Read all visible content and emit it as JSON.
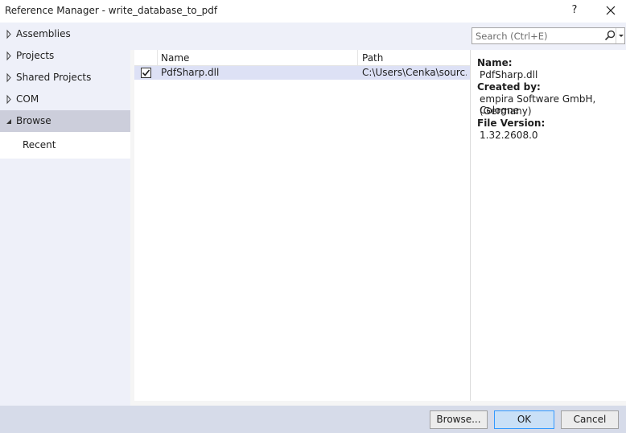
{
  "window": {
    "title": "Reference Manager - write_database_to_pdf",
    "help_label": "?"
  },
  "nav": {
    "items": [
      {
        "label": "Assemblies"
      },
      {
        "label": "Projects"
      },
      {
        "label": "Shared Projects"
      },
      {
        "label": "COM"
      },
      {
        "label": "Browse"
      }
    ],
    "sub_items": [
      {
        "label": "Recent"
      }
    ],
    "selected": "Browse"
  },
  "search": {
    "placeholder": "Search (Ctrl+E)"
  },
  "table": {
    "columns": [
      "Name",
      "Path"
    ],
    "rows": [
      {
        "checked": true,
        "name": "PdfSharp.dll",
        "path": "C:\\Users\\Cenka\\sourc..."
      }
    ]
  },
  "details": {
    "name_label": "Name:",
    "name_value": "PdfSharp.dll",
    "created_label": "Created by:",
    "created_value_line1": "empira Software GmbH, Cologne",
    "created_value_line2": "(Germany)",
    "version_label": "File Version:",
    "version_value": "1.32.2608.0"
  },
  "buttons": {
    "browse": "Browse...",
    "ok": "OK",
    "cancel": "Cancel"
  }
}
